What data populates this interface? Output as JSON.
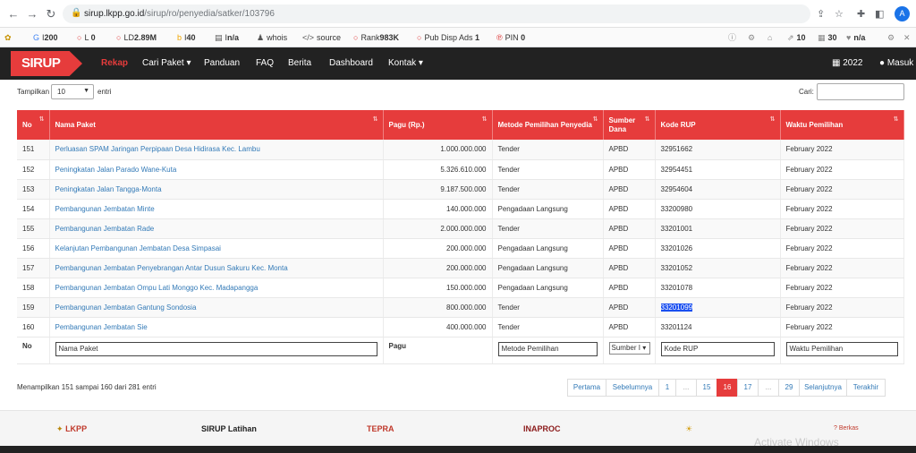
{
  "browser": {
    "url_host": "sirup.lkpp.go.id",
    "url_path": "/sirup/ro/penyedia/satker/103796",
    "profile_initial": "A"
  },
  "extensions": [
    {
      "icon": "G",
      "label": "I",
      "value": "200"
    },
    {
      "icon": "○",
      "label": "L",
      "value": "0"
    },
    {
      "icon": "○",
      "label": "LD",
      "value": "2.89M"
    },
    {
      "icon": "b",
      "label": "I",
      "value": "40"
    },
    {
      "icon": "▤",
      "label": "I",
      "value": "n/a"
    },
    {
      "icon": "♟",
      "label": "whois",
      "value": ""
    },
    {
      "icon": "</>",
      "label": "source",
      "value": ""
    },
    {
      "icon": "○",
      "label": "Rank",
      "value": "983K"
    },
    {
      "icon": "○",
      "label": "Pub Disp Ads",
      "value": "1"
    },
    {
      "icon": "℗",
      "label": "PIN",
      "value": "0"
    }
  ],
  "extensions_right": [
    {
      "label": "",
      "value": "10"
    },
    {
      "label": "",
      "value": "30"
    },
    {
      "label": "",
      "value": "n/a"
    }
  ],
  "site": {
    "logo": "SIRUP",
    "nav": [
      "Rekap",
      "Cari Paket ▾",
      "Panduan",
      "FAQ",
      "Berita",
      "Dashboard",
      "Kontak ▾"
    ],
    "year": "2022",
    "login": "Masuk"
  },
  "controls": {
    "show_label": "Tampilkan",
    "page_length": "10",
    "entries_label": "entri",
    "search_label": "Cari:"
  },
  "table": {
    "headers": [
      "No",
      "Nama Paket",
      "Pagu (Rp.)",
      "Metode Pemilihan Penyedia",
      "Sumber Dana",
      "Kode RUP",
      "Waktu Pemilihan"
    ],
    "rows": [
      [
        "151",
        "Perluasan SPAM Jaringan Perpipaan Desa Hidirasa Kec. Lambu",
        "1.000.000.000",
        "Tender",
        "APBD",
        "32951662",
        "February 2022"
      ],
      [
        "152",
        "Peningkatan Jalan Parado Wane-Kuta",
        "5.326.610.000",
        "Tender",
        "APBD",
        "32954451",
        "February 2022"
      ],
      [
        "153",
        "Peningkatan Jalan Tangga-Monta",
        "9.187.500.000",
        "Tender",
        "APBD",
        "32954604",
        "February 2022"
      ],
      [
        "154",
        "Pembangunan Jembatan Minte",
        "140.000.000",
        "Pengadaan Langsung",
        "APBD",
        "33200980",
        "February 2022"
      ],
      [
        "155",
        "Pembangunan Jembatan Rade",
        "2.000.000.000",
        "Tender",
        "APBD",
        "33201001",
        "February 2022"
      ],
      [
        "156",
        "Kelanjutan Pembangunan Jembatan Desa Simpasai",
        "200.000.000",
        "Pengadaan Langsung",
        "APBD",
        "33201026",
        "February 2022"
      ],
      [
        "157",
        "Pembangunan Jembatan Penyebrangan Antar Dusun Sakuru Kec. Monta",
        "200.000.000",
        "Pengadaan Langsung",
        "APBD",
        "33201052",
        "February 2022"
      ],
      [
        "158",
        "Pembangunan Jembatan Ompu Lati Monggo Kec. Madapangga",
        "150.000.000",
        "Pengadaan Langsung",
        "APBD",
        "33201078",
        "February 2022"
      ],
      [
        "159",
        "Pembangunan Jembatan Gantung Sondosia",
        "800.000.000",
        "Tender",
        "APBD",
        "33201099",
        "February 2022"
      ],
      [
        "160",
        "Pembangunan Jembatan Sie",
        "400.000.000",
        "Tender",
        "APBD",
        "33201124",
        "February 2022"
      ]
    ],
    "footer": {
      "no": "No",
      "nama": "Nama Paket",
      "pagu": "Pagu",
      "metode": "Metode Pemilihan",
      "sumber": "Sumber I",
      "kode": "Kode RUP",
      "waktu": "Waktu Pemilihan"
    }
  },
  "info": "Menampilkan 151 sampai 160 dari 281 entri",
  "pagination": [
    "Pertama",
    "Sebelumnya",
    "1",
    "...",
    "15",
    "16",
    "17",
    "...",
    "29",
    "Selanjutnya",
    "Terakhir"
  ],
  "partners": [
    "LKPP",
    "SIRUP Latihan",
    "TEPRA",
    "INAPROC",
    "",
    "Berkas"
  ],
  "watermark": "Activate Windows",
  "colors": {
    "accent": "#e63c3c",
    "nav_bg": "#222222",
    "link": "#337ab7"
  }
}
